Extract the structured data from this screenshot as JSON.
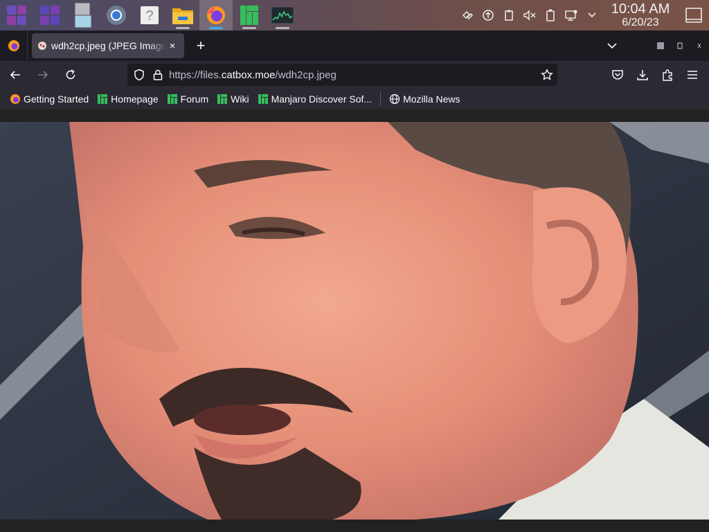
{
  "taskbar": {
    "apps": [
      {
        "name": "app-launcher",
        "active": false
      },
      {
        "name": "overview",
        "active": false
      },
      {
        "name": "system-settings",
        "active": false
      },
      {
        "name": "chromium",
        "active": false
      },
      {
        "name": "help",
        "active": false
      },
      {
        "name": "file-manager",
        "active": false
      },
      {
        "name": "firefox",
        "active": true
      },
      {
        "name": "manjaro-hello",
        "active": false
      },
      {
        "name": "system-monitor",
        "active": false
      }
    ],
    "clock": {
      "time": "10:04 AM",
      "date": "6/20/23"
    }
  },
  "tabs": [
    {
      "title": "wdh2cp.jpeg (JPEG Image...",
      "close_label": "×"
    }
  ],
  "newtab_label": "+",
  "window_controls": {
    "close_label": "x"
  },
  "urlbar": {
    "prefix": "https://files.",
    "host": "catbox.moe",
    "path": "/wdh2cp.jpeg"
  },
  "bookmarks": [
    {
      "label": "Getting Started",
      "icon": "firefox-icon"
    },
    {
      "label": "Homepage",
      "icon": "manjaro-icon"
    },
    {
      "label": "Forum",
      "icon": "manjaro-icon"
    },
    {
      "label": "Wiki",
      "icon": "manjaro-icon"
    },
    {
      "label": "Manjaro Discover Sof...",
      "icon": "manjaro-icon"
    },
    {
      "label": "Mozilla News",
      "icon": "globe-icon"
    }
  ],
  "colors": {
    "manjaro_green": "#35bf5c",
    "accent_blue": "#3daee9",
    "browser_dark": "#1c1b22",
    "toolbar": "#2b2a33"
  }
}
